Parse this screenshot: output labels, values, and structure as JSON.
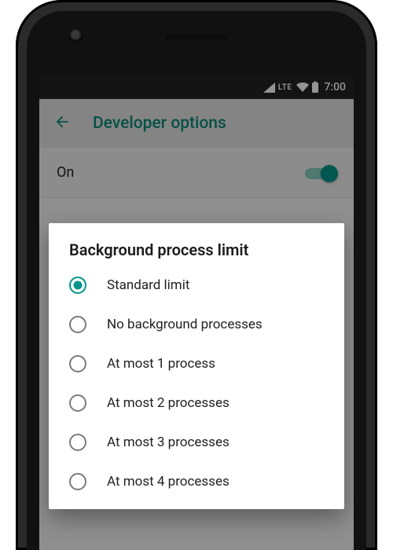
{
  "status": {
    "network": "LTE",
    "time": "7:00"
  },
  "appbar": {
    "title": "Developer options"
  },
  "toggle": {
    "label": "On",
    "state": "on"
  },
  "dialog": {
    "title": "Background process limit",
    "options": [
      {
        "label": "Standard limit",
        "selected": true
      },
      {
        "label": "No background processes",
        "selected": false
      },
      {
        "label": "At most 1 process",
        "selected": false
      },
      {
        "label": "At most 2 processes",
        "selected": false
      },
      {
        "label": "At most 3 processes",
        "selected": false
      },
      {
        "label": "At most 4 processes",
        "selected": false
      }
    ]
  }
}
